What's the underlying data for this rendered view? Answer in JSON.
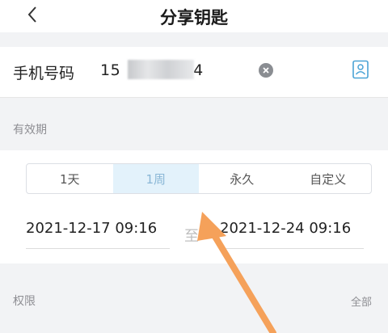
{
  "header": {
    "title": "分享钥匙"
  },
  "phone": {
    "label": "手机号码",
    "value": "15         4"
  },
  "validity": {
    "section_label": "有效期",
    "options": [
      "1天",
      "1周",
      "永久",
      "自定义"
    ],
    "selected": "1周",
    "start": "2021-12-17 09:16",
    "to_label": "至",
    "end": "2021-12-24 09:16"
  },
  "permissions": {
    "label": "权限",
    "action": "全部"
  },
  "colors": {
    "accent_arrow": "#f5a15a",
    "selected_tab_bg": "#e3f2fb",
    "selected_tab_text": "#8ab7d6"
  },
  "icons": {
    "back": "chevron-left-icon",
    "clear": "clear-circle-icon",
    "contact": "contact-book-icon"
  }
}
